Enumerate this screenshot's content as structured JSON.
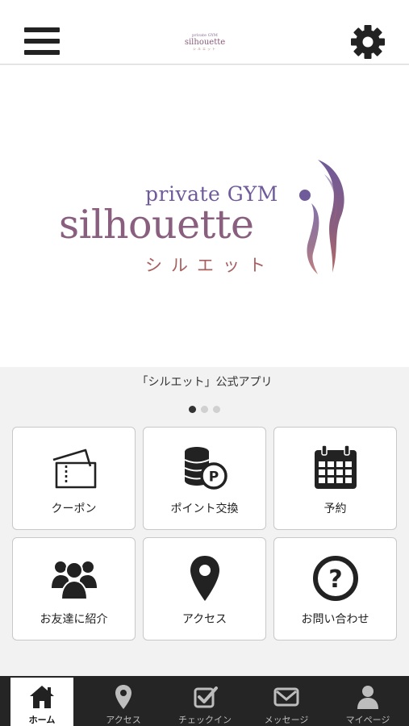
{
  "header": {
    "menu_icon": "hamburger-menu-icon",
    "settings_icon": "gear-icon",
    "small_logo": {
      "top": "private GYM",
      "main": "silhouette",
      "sub": "シルエット"
    }
  },
  "hero": {
    "logo_private": "private GYM",
    "logo_main": "silhouette",
    "logo_kana": "シルエット",
    "colors": {
      "purple": "#6f5a9a",
      "mauve": "#8a5e7e",
      "rose": "#a7605f"
    }
  },
  "slider": {
    "caption": "「シルエット」公式アプリ",
    "dots": 3,
    "active_index": 0
  },
  "menu": {
    "items": [
      {
        "label": "クーポン",
        "icon": "ticket-icon"
      },
      {
        "label": "ポイント交換",
        "icon": "coin-stack-icon"
      },
      {
        "label": "予約",
        "icon": "calendar-icon"
      },
      {
        "label": "お友達に紹介",
        "icon": "group-icon"
      },
      {
        "label": "アクセス",
        "icon": "map-pin-icon"
      },
      {
        "label": "お問い合わせ",
        "icon": "question-circle-icon"
      }
    ]
  },
  "tabbar": {
    "items": [
      {
        "label": "ホーム",
        "icon": "home-icon",
        "active": true
      },
      {
        "label": "アクセス",
        "icon": "map-pin-icon",
        "active": false
      },
      {
        "label": "チェックイン",
        "icon": "checkbox-icon",
        "active": false
      },
      {
        "label": "メッセージ",
        "icon": "envelope-icon",
        "active": false
      },
      {
        "label": "マイページ",
        "icon": "person-icon",
        "active": false
      }
    ]
  }
}
